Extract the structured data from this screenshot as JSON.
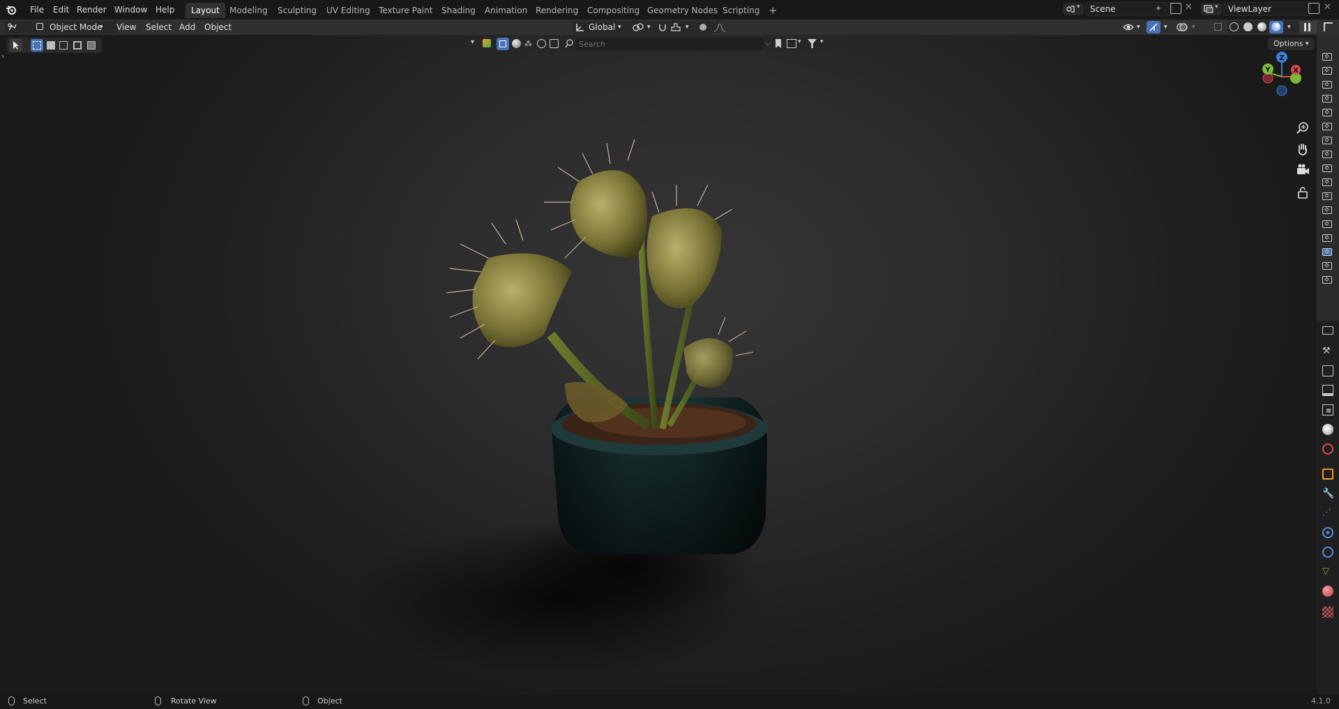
{
  "menu": {
    "file": "File",
    "edit": "Edit",
    "render": "Render",
    "window": "Window",
    "help": "Help"
  },
  "workspaces": [
    {
      "label": "Layout",
      "active": true
    },
    {
      "label": "Modeling"
    },
    {
      "label": "Sculpting"
    },
    {
      "label": "UV Editing"
    },
    {
      "label": "Texture Paint"
    },
    {
      "label": "Shading"
    },
    {
      "label": "Animation"
    },
    {
      "label": "Rendering"
    },
    {
      "label": "Compositing"
    },
    {
      "label": "Geometry Nodes"
    },
    {
      "label": "Scripting"
    }
  ],
  "add_workspace": "+",
  "scene": {
    "name": "Scene"
  },
  "viewlayer": {
    "name": "ViewLayer"
  },
  "header": {
    "mode": "Object Mode",
    "view": "View",
    "select": "Select",
    "add": "Add",
    "object": "Object",
    "transform_orientation": "Global",
    "options": "Options"
  },
  "search": {
    "placeholder": "Search"
  },
  "gizmo": {
    "z": "Z",
    "y": "Y",
    "x": "X"
  },
  "status": {
    "select": "Select",
    "rotate": "Rotate View",
    "object": "Object",
    "version": "4.1.0"
  },
  "colors": {
    "accent": "#4772b3",
    "axis_x": "#e0474e",
    "axis_y": "#7bb83a",
    "axis_z": "#3b7fd9"
  }
}
